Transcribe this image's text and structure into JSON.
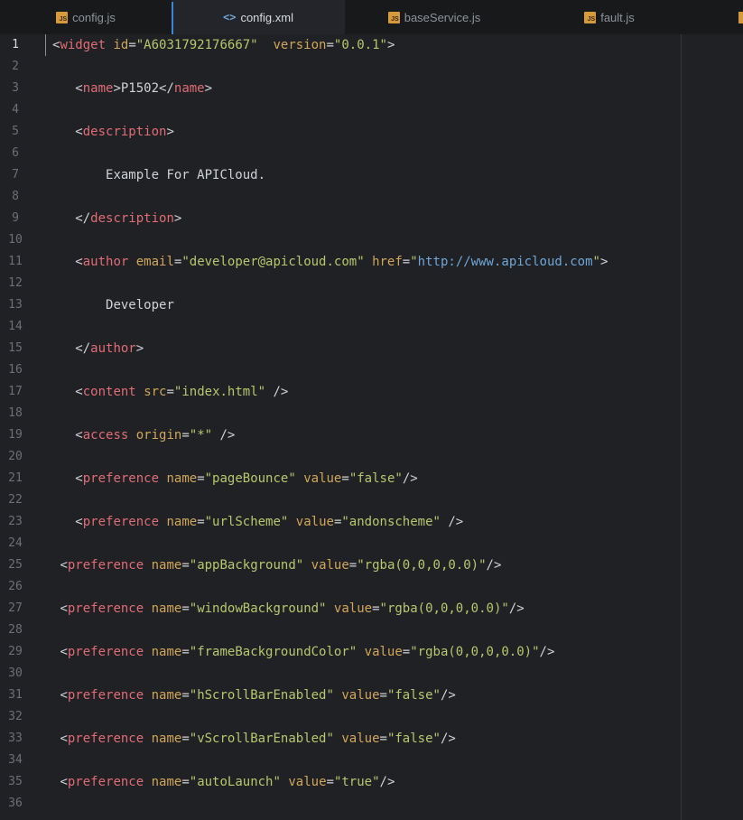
{
  "tabs": [
    {
      "label": "config.js",
      "icon": "js-file-icon",
      "active": false
    },
    {
      "label": "config.xml",
      "icon": "xml-code-icon",
      "active": true
    },
    {
      "label": "baseService.js",
      "icon": "js-file-icon",
      "active": false
    },
    {
      "label": "fault.js",
      "icon": "js-file-icon",
      "active": false
    }
  ],
  "editor": {
    "current_line": 1,
    "lines": [
      {
        "n": "1",
        "indent": "",
        "tokens": [
          [
            "p",
            "<"
          ],
          [
            "t",
            "widget"
          ],
          [
            "p",
            " "
          ],
          [
            "a",
            "id"
          ],
          [
            "p",
            "="
          ],
          [
            "v",
            "\"A6031792176667\""
          ],
          [
            "p",
            "  "
          ],
          [
            "a",
            "version"
          ],
          [
            "p",
            "="
          ],
          [
            "v",
            "\"0.0.1\""
          ],
          [
            "p",
            ">"
          ]
        ]
      },
      {
        "n": "2",
        "indent": "",
        "tokens": []
      },
      {
        "n": "3",
        "indent": "   ",
        "tokens": [
          [
            "p",
            "<"
          ],
          [
            "t",
            "name"
          ],
          [
            "p",
            ">P1502</"
          ],
          [
            "t",
            "name"
          ],
          [
            "p",
            ">"
          ]
        ]
      },
      {
        "n": "4",
        "indent": "",
        "tokens": []
      },
      {
        "n": "5",
        "indent": "   ",
        "tokens": [
          [
            "p",
            "<"
          ],
          [
            "t",
            "description"
          ],
          [
            "p",
            ">"
          ]
        ]
      },
      {
        "n": "6",
        "indent": "",
        "tokens": []
      },
      {
        "n": "7",
        "indent": "       ",
        "tokens": [
          [
            "p",
            "Example For APICloud."
          ]
        ]
      },
      {
        "n": "8",
        "indent": "",
        "tokens": []
      },
      {
        "n": "9",
        "indent": "   ",
        "tokens": [
          [
            "p",
            "</"
          ],
          [
            "t",
            "description"
          ],
          [
            "p",
            ">"
          ]
        ]
      },
      {
        "n": "10",
        "indent": "",
        "tokens": []
      },
      {
        "n": "11",
        "indent": "   ",
        "tokens": [
          [
            "p",
            "<"
          ],
          [
            "t",
            "author"
          ],
          [
            "p",
            " "
          ],
          [
            "a",
            "email"
          ],
          [
            "p",
            "="
          ],
          [
            "v",
            "\"developer@apicloud.com\""
          ],
          [
            "p",
            " "
          ],
          [
            "a",
            "href"
          ],
          [
            "p",
            "="
          ],
          [
            "v",
            "\""
          ],
          [
            "u",
            "http://www.apicloud.com"
          ],
          [
            "v",
            "\""
          ],
          [
            "p",
            ">"
          ]
        ]
      },
      {
        "n": "12",
        "indent": "",
        "tokens": []
      },
      {
        "n": "13",
        "indent": "       ",
        "tokens": [
          [
            "p",
            "Developer"
          ]
        ]
      },
      {
        "n": "14",
        "indent": "",
        "tokens": []
      },
      {
        "n": "15",
        "indent": "   ",
        "tokens": [
          [
            "p",
            "</"
          ],
          [
            "t",
            "author"
          ],
          [
            "p",
            ">"
          ]
        ]
      },
      {
        "n": "16",
        "indent": "",
        "tokens": []
      },
      {
        "n": "17",
        "indent": "   ",
        "tokens": [
          [
            "p",
            "<"
          ],
          [
            "t",
            "content"
          ],
          [
            "p",
            " "
          ],
          [
            "a",
            "src"
          ],
          [
            "p",
            "="
          ],
          [
            "v",
            "\"index.html\""
          ],
          [
            "p",
            " />"
          ]
        ]
      },
      {
        "n": "18",
        "indent": "",
        "tokens": []
      },
      {
        "n": "19",
        "indent": "   ",
        "tokens": [
          [
            "p",
            "<"
          ],
          [
            "t",
            "access"
          ],
          [
            "p",
            " "
          ],
          [
            "a",
            "origin"
          ],
          [
            "p",
            "="
          ],
          [
            "v",
            "\"*\""
          ],
          [
            "p",
            " />"
          ]
        ]
      },
      {
        "n": "20",
        "indent": "",
        "tokens": []
      },
      {
        "n": "21",
        "indent": "   ",
        "tokens": [
          [
            "p",
            "<"
          ],
          [
            "t",
            "preference"
          ],
          [
            "p",
            " "
          ],
          [
            "a",
            "name"
          ],
          [
            "p",
            "="
          ],
          [
            "v",
            "\"pageBounce\""
          ],
          [
            "p",
            " "
          ],
          [
            "a",
            "value"
          ],
          [
            "p",
            "="
          ],
          [
            "v",
            "\"false\""
          ],
          [
            "p",
            "/>"
          ]
        ]
      },
      {
        "n": "22",
        "indent": "",
        "tokens": []
      },
      {
        "n": "23",
        "indent": "   ",
        "tokens": [
          [
            "p",
            "<"
          ],
          [
            "t",
            "preference"
          ],
          [
            "p",
            " "
          ],
          [
            "a",
            "name"
          ],
          [
            "p",
            "="
          ],
          [
            "v",
            "\"urlScheme\""
          ],
          [
            "p",
            " "
          ],
          [
            "a",
            "value"
          ],
          [
            "p",
            "="
          ],
          [
            "v",
            "\"andonscheme\""
          ],
          [
            "p",
            " />"
          ]
        ]
      },
      {
        "n": "24",
        "indent": "",
        "tokens": []
      },
      {
        "n": "25",
        "indent": " ",
        "tokens": [
          [
            "p",
            "<"
          ],
          [
            "t",
            "preference"
          ],
          [
            "p",
            " "
          ],
          [
            "a",
            "name"
          ],
          [
            "p",
            "="
          ],
          [
            "v",
            "\"appBackground\""
          ],
          [
            "p",
            " "
          ],
          [
            "a",
            "value"
          ],
          [
            "p",
            "="
          ],
          [
            "v",
            "\"rgba(0,0,0,0.0)\""
          ],
          [
            "p",
            "/>"
          ]
        ]
      },
      {
        "n": "26",
        "indent": "",
        "tokens": []
      },
      {
        "n": "27",
        "indent": " ",
        "tokens": [
          [
            "p",
            "<"
          ],
          [
            "t",
            "preference"
          ],
          [
            "p",
            " "
          ],
          [
            "a",
            "name"
          ],
          [
            "p",
            "="
          ],
          [
            "v",
            "\"windowBackground\""
          ],
          [
            "p",
            " "
          ],
          [
            "a",
            "value"
          ],
          [
            "p",
            "="
          ],
          [
            "v",
            "\"rgba(0,0,0,0.0)\""
          ],
          [
            "p",
            "/>"
          ]
        ]
      },
      {
        "n": "28",
        "indent": "",
        "tokens": []
      },
      {
        "n": "29",
        "indent": " ",
        "tokens": [
          [
            "p",
            "<"
          ],
          [
            "t",
            "preference"
          ],
          [
            "p",
            " "
          ],
          [
            "a",
            "name"
          ],
          [
            "p",
            "="
          ],
          [
            "v",
            "\"frameBackgroundColor\""
          ],
          [
            "p",
            " "
          ],
          [
            "a",
            "value"
          ],
          [
            "p",
            "="
          ],
          [
            "v",
            "\"rgba(0,0,0,0.0)\""
          ],
          [
            "p",
            "/>"
          ]
        ]
      },
      {
        "n": "30",
        "indent": "",
        "tokens": []
      },
      {
        "n": "31",
        "indent": " ",
        "tokens": [
          [
            "p",
            "<"
          ],
          [
            "t",
            "preference"
          ],
          [
            "p",
            " "
          ],
          [
            "a",
            "name"
          ],
          [
            "p",
            "="
          ],
          [
            "v",
            "\"hScrollBarEnabled\""
          ],
          [
            "p",
            " "
          ],
          [
            "a",
            "value"
          ],
          [
            "p",
            "="
          ],
          [
            "v",
            "\"false\""
          ],
          [
            "p",
            "/>"
          ]
        ]
      },
      {
        "n": "32",
        "indent": "",
        "tokens": []
      },
      {
        "n": "33",
        "indent": " ",
        "tokens": [
          [
            "p",
            "<"
          ],
          [
            "t",
            "preference"
          ],
          [
            "p",
            " "
          ],
          [
            "a",
            "name"
          ],
          [
            "p",
            "="
          ],
          [
            "v",
            "\"vScrollBarEnabled\""
          ],
          [
            "p",
            " "
          ],
          [
            "a",
            "value"
          ],
          [
            "p",
            "="
          ],
          [
            "v",
            "\"false\""
          ],
          [
            "p",
            "/>"
          ]
        ]
      },
      {
        "n": "34",
        "indent": "",
        "tokens": []
      },
      {
        "n": "35",
        "indent": " ",
        "tokens": [
          [
            "p",
            "<"
          ],
          [
            "t",
            "preference"
          ],
          [
            "p",
            " "
          ],
          [
            "a",
            "name"
          ],
          [
            "p",
            "="
          ],
          [
            "v",
            "\"autoLaunch\""
          ],
          [
            "p",
            " "
          ],
          [
            "a",
            "value"
          ],
          [
            "p",
            "="
          ],
          [
            "v",
            "\"true\""
          ],
          [
            "p",
            "/>"
          ]
        ]
      },
      {
        "n": "36",
        "indent": "",
        "tokens": []
      }
    ]
  }
}
